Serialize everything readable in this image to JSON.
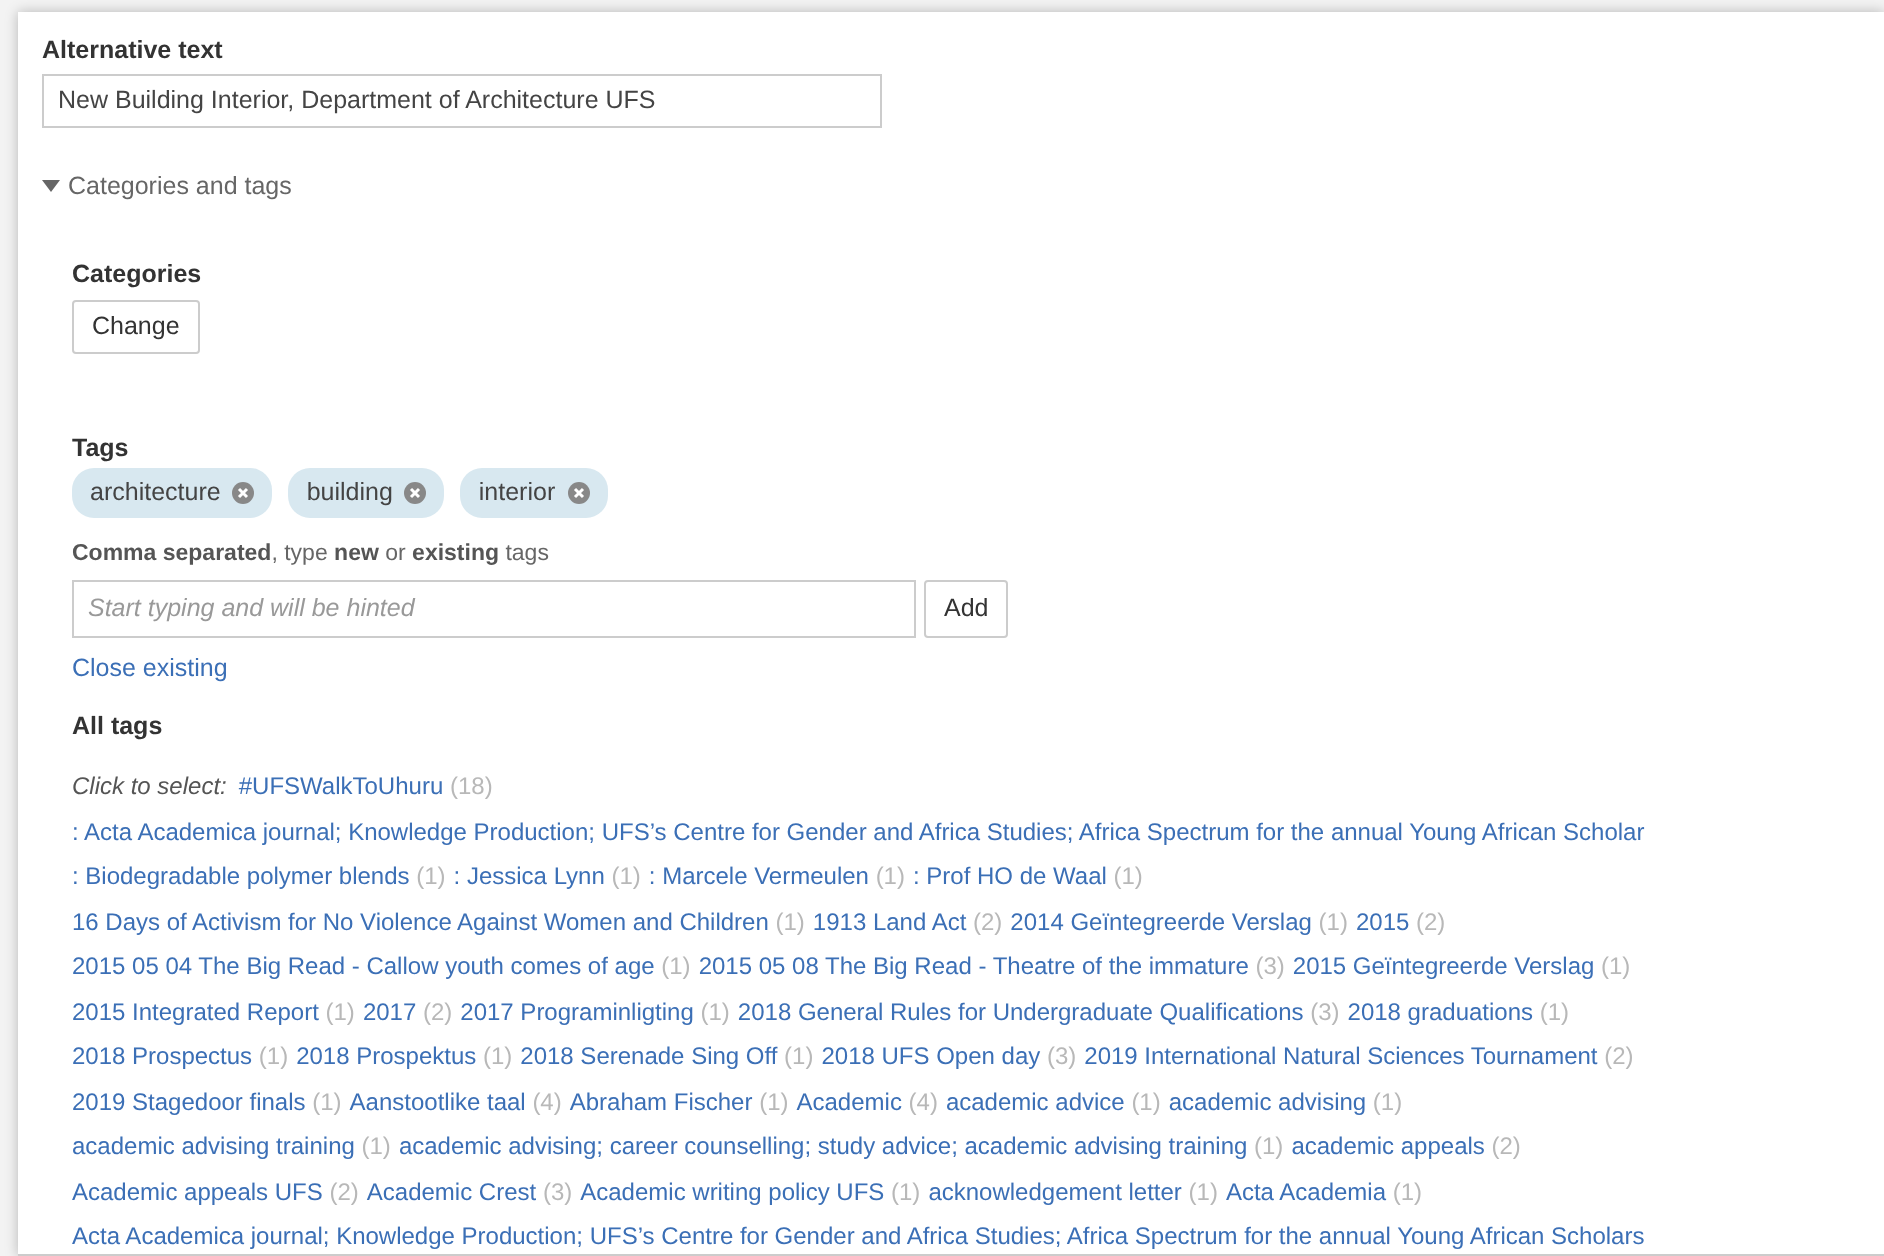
{
  "alt_text": {
    "label": "Alternative text",
    "value": "New Building Interior, Department of Architecture UFS"
  },
  "section": {
    "title": "Categories and tags",
    "expanded": true
  },
  "categories": {
    "label": "Categories",
    "button": "Change"
  },
  "tags": {
    "label": "Tags",
    "chips": [
      "architecture",
      "building",
      "interior"
    ],
    "hint": "**Comma separated**, type **new** or **existing** tags",
    "input": {
      "placeholder": "Start typing and will be hinted"
    },
    "add_button": "Add",
    "close_link": "Close existing"
  },
  "all_tags": {
    "label": "All tags",
    "prompt": "Click to select:",
    "lines": [
      [
        {
          "label": "#UFSWalkToUhuru",
          "count": "(18)"
        }
      ],
      [
        {
          "label": ": Acta Academica journal; Knowledge Production; UFS’s Centre for Gender and Africa Studies; Africa Spectrum for the annual Young African Scholar"
        }
      ],
      [
        {
          "label": ": Biodegradable polymer blends",
          "count": "(1)"
        },
        {
          "label": ": Jessica Lynn",
          "count": "(1)"
        },
        {
          "label": ": Marcele Vermeulen",
          "count": "(1)"
        },
        {
          "label": ": Prof HO de Waal",
          "count": "(1)"
        }
      ],
      [
        {
          "label": "16 Days of Activism for No Violence Against Women and Children",
          "count": "(1)"
        },
        {
          "label": "1913 Land Act",
          "count": "(2)"
        },
        {
          "label": "2014 Geïntegreerde Verslag",
          "count": "(1)"
        },
        {
          "label": "2015",
          "count": "(2)"
        }
      ],
      [
        {
          "label": "2015 05 04 The Big Read - Callow youth comes of age",
          "count": "(1)"
        },
        {
          "label": "2015 05 08 The Big Read - Theatre of the immature",
          "count": "(3)"
        },
        {
          "label": "2015 Geïntegreerde Verslag",
          "count": "(1)"
        }
      ],
      [
        {
          "label": "2015 Integrated Report",
          "count": "(1)"
        },
        {
          "label": "2017",
          "count": "(2)"
        },
        {
          "label": "2017 Programinligting",
          "count": "(1)"
        },
        {
          "label": "2018 General Rules for Undergraduate Qualifications",
          "count": "(3)"
        },
        {
          "label": "2018 graduations",
          "count": "(1)"
        }
      ],
      [
        {
          "label": "2018 Prospectus",
          "count": "(1)"
        },
        {
          "label": "2018 Prospektus",
          "count": "(1)"
        },
        {
          "label": "2018 Serenade Sing Off",
          "count": "(1)"
        },
        {
          "label": "2018 UFS Open day",
          "count": "(3)"
        },
        {
          "label": "2019 International Natural Sciences Tournament",
          "count": "(2)"
        }
      ],
      [
        {
          "label": "2019 Stagedoor finals",
          "count": "(1)"
        },
        {
          "label": "Aanstootlike taal",
          "count": "(4)"
        },
        {
          "label": "Abraham Fischer",
          "count": "(1)"
        },
        {
          "label": "Academic",
          "count": "(4)"
        },
        {
          "label": "academic advice",
          "count": "(1)"
        },
        {
          "label": "academic advising",
          "count": "(1)"
        }
      ],
      [
        {
          "label": "academic advising training",
          "count": "(1)"
        },
        {
          "label": "academic advising; career counselling; study advice; academic advising training",
          "count": "(1)"
        },
        {
          "label": "academic appeals",
          "count": "(2)"
        }
      ],
      [
        {
          "label": "Academic appeals UFS",
          "count": "(2)"
        },
        {
          "label": "Academic Crest",
          "count": "(3)"
        },
        {
          "label": "Academic writing policy UFS",
          "count": "(1)"
        },
        {
          "label": "acknowledgement letter",
          "count": "(1)"
        },
        {
          "label": "Acta Academia",
          "count": "(1)"
        }
      ],
      [
        {
          "label": "Acta Academica journal; Knowledge Production; UFS’s Centre for Gender and Africa Studies; Africa Spectrum for the annual Young African Scholars"
        }
      ]
    ]
  }
}
